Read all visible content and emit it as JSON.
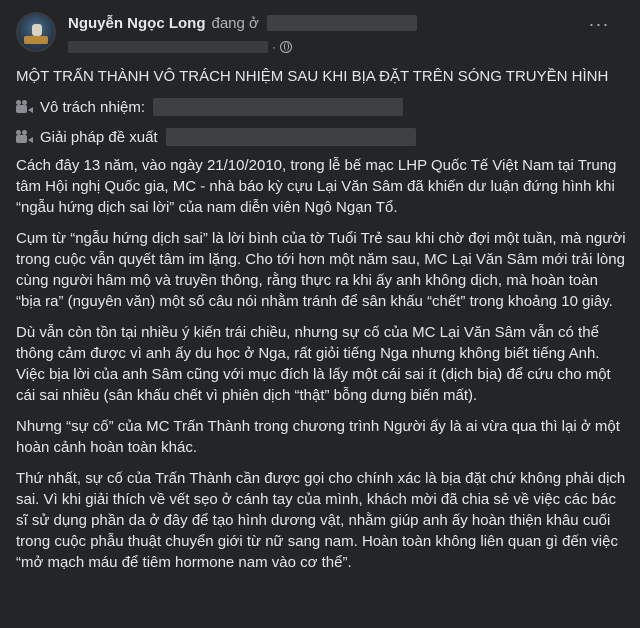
{
  "post": {
    "author": "Nguyễn Ngọc Long",
    "location_prefix": "đang ở",
    "more_glyph": "···",
    "dot": "·",
    "title": "MỘT TRẤN THÀNH VÔ TRÁCH NHIỆM SAU KHI BỊA ĐẶT TRÊN SÓNG TRUYỀN HÌNH",
    "lines": [
      {
        "label": "Vô trách nhiệm:"
      },
      {
        "label": "Giải pháp đề xuất"
      }
    ],
    "paragraphs": [
      "Cách đây 13 năm, vào ngày 21/10/2010, trong lễ bế mạc LHP Quốc Tế Việt Nam tại Trung tâm Hội nghị Quốc gia, MC - nhà báo kỳ cựu Lại Văn Sâm đã khiến dư luận đứng hình khi “ngẫu hứng dịch sai lời” của nam diễn viên Ngô Ngạn Tổ.",
      "Cụm từ “ngẫu hứng dịch sai” là lời bình của tờ Tuổi Trẻ sau khi chờ đợi một tuần, mà người trong cuộc vẫn quyết tâm im lặng. Cho tới hơn một năm sau, MC Lại Văn Sâm mới trải lòng cùng người hâm mộ và truyền thông, rằng thực ra khi ấy anh không dịch, mà hoàn toàn “bịa ra” (nguyên văn) một số câu nói nhằm tránh để sân khấu “chết” trong khoảng 10 giây.",
      "Dù vẫn còn tồn tại nhiều ý kiến trái chiều, nhưng sự cố của MC Lại Văn Sâm vẫn có thể thông cảm được vì anh ấy du học ở Nga, rất giỏi tiếng Nga nhưng không biết tiếng Anh. Việc bịa lời của anh Sâm cũng với mục đích là lấy một cái sai ít (dịch bịa) để cứu cho một cái sai nhiều (sân khấu chết vì phiên dịch “thật” bỗng dưng biến mất).",
      "Nhưng “sự cố” của MC Trấn Thành trong chương trình Người ấy là ai vừa qua thì lại ở một hoàn cảnh hoàn toàn khác.",
      "Thứ nhất, sự cố của Trấn Thành cần được gọi cho chính xác là bịa đặt chứ không phải dịch sai. Vì khi giải thích về vết sẹo ở cánh tay của mình, khách mời đã chia sẻ về việc các bác sĩ sử dụng phần da ở đây để tạo hình dương vật, nhằm giúp anh ấy hoàn thiện khâu cuối trong cuộc phẫu thuật chuyển giới từ nữ sang nam. Hoàn toàn không liên quan gì đến việc “mở mạch máu để tiêm hormone nam vào cơ thể”."
    ]
  }
}
